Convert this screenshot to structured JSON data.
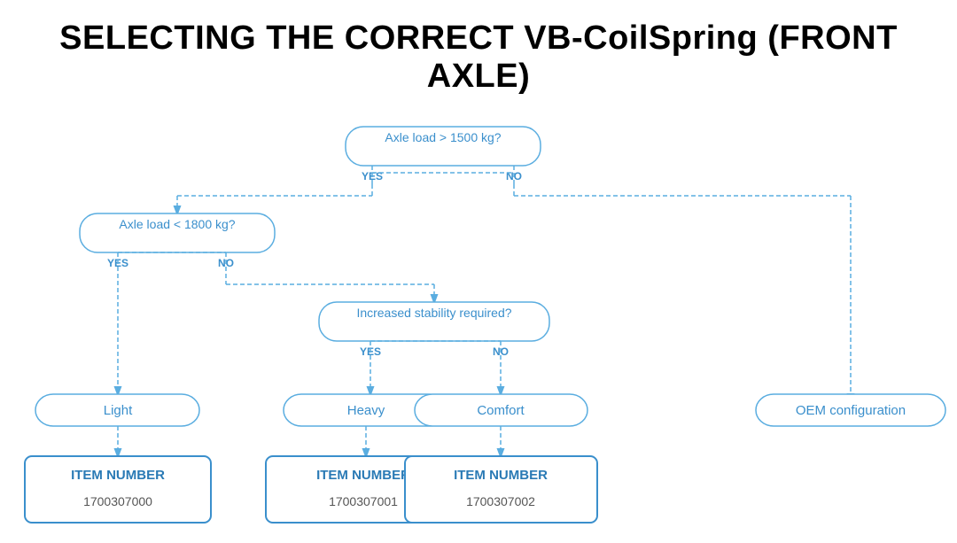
{
  "title": "SELECTING THE CORRECT VB-CoilSpring (FRONT AXLE)",
  "diagram": {
    "node_axle1500": {
      "label": "Axle load > 1500 kg?",
      "yes": "YES",
      "no": "NO"
    },
    "node_axle1800": {
      "label": "Axle load < 1800 kg?",
      "yes": "YES",
      "no": "NO"
    },
    "node_stability": {
      "label": "Increased stability required?",
      "yes": "YES",
      "no": "NO"
    },
    "categories": [
      {
        "label": "Light"
      },
      {
        "label": "Heavy"
      },
      {
        "label": "Comfort"
      },
      {
        "label": "OEM configuration"
      }
    ],
    "items": [
      {
        "title": "ITEM NUMBER",
        "number": "1700307000"
      },
      {
        "title": "ITEM NUMBER",
        "number": "1700307001"
      },
      {
        "title": "ITEM NUMBER",
        "number": "1700307002"
      }
    ]
  }
}
